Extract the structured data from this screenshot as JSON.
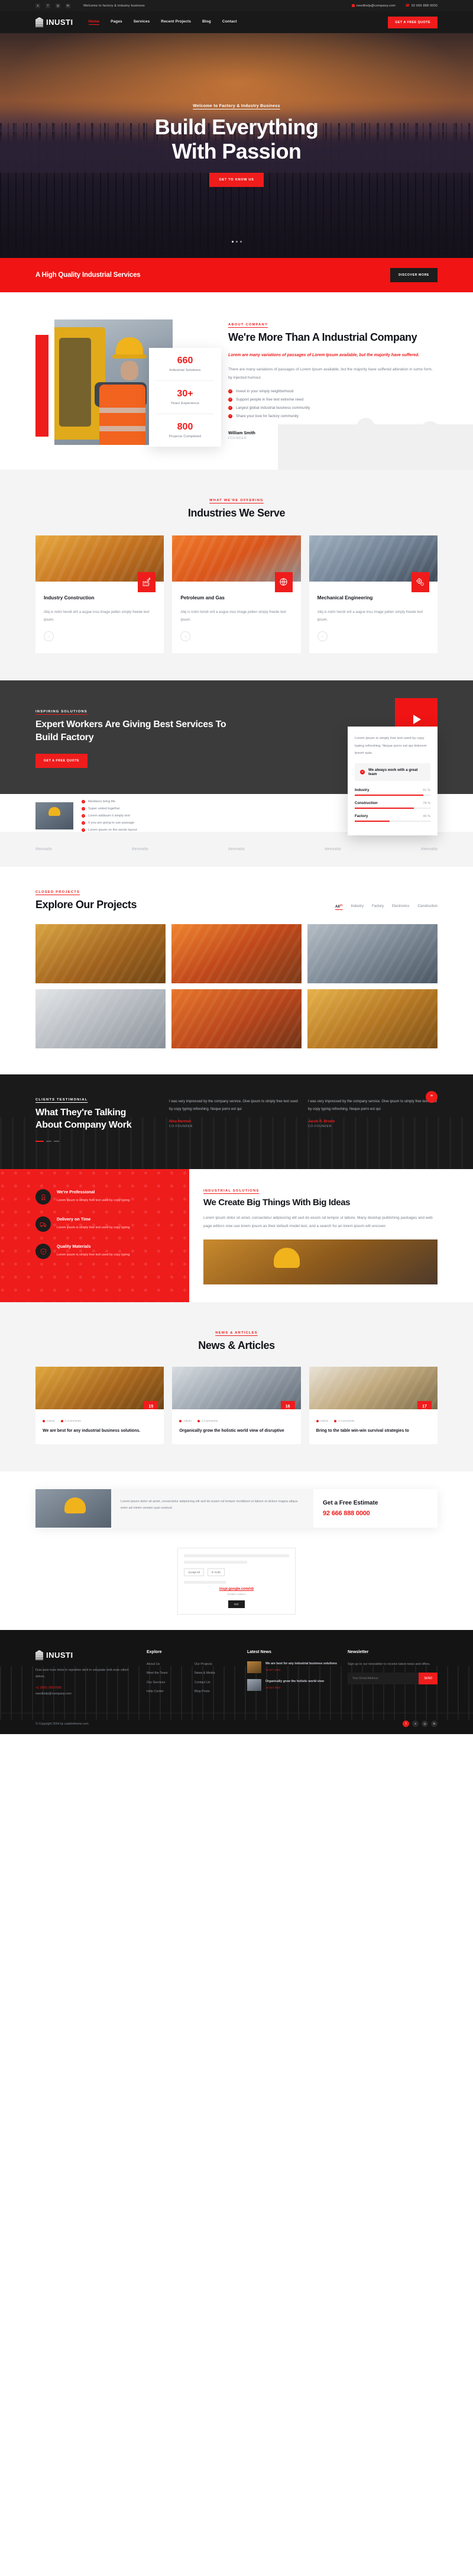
{
  "topbar": {
    "social": [
      "twitter-icon",
      "facebook-icon",
      "instagram-icon",
      "linkedin-icon"
    ],
    "welcome": "Welcome to factory & industry business",
    "email": "needhelp@company.com",
    "phone": "92 666 888 0000"
  },
  "nav": {
    "logo": "INUSTI",
    "items": [
      {
        "label": "Home",
        "active": true
      },
      {
        "label": "Pages",
        "active": false
      },
      {
        "label": "Services",
        "active": false
      },
      {
        "label": "Recent Projects",
        "active": false
      },
      {
        "label": "Blog",
        "active": false
      },
      {
        "label": "Contact",
        "active": false
      }
    ],
    "cta": "GET A FREE QUOTE"
  },
  "hero": {
    "subtitle": "Welcome to Factory & Industry Business",
    "title_line1": "Build Everything",
    "title_line2": "With Passion",
    "button": "GET TO KNOW US"
  },
  "strip": {
    "title": "A High Quality Industrial Services",
    "button": "DISCOVER MORE"
  },
  "about": {
    "eyebrow": "ABOUT COMPANY",
    "title": "We're More Than A Industrial Company",
    "lead": "Lorem are many variations of passages of Lorem Ipsum available, but the majority have suffered.",
    "paragraph": "There are many variations of passages of Lorem Ipsum available, but the majority have suffered alteration in some form, by injected humour.",
    "checks": [
      "Invest in your simply neighborhood",
      "Support people in free text extreme need",
      "Largest global industrial business community",
      "Share your love for factory community"
    ],
    "stats": [
      {
        "value": "660",
        "label": "Industrial Solutions"
      },
      {
        "value": "30+",
        "label": "Years Experience"
      },
      {
        "value": "800",
        "label": "Projects Completed"
      }
    ],
    "signer_name": "William Smith",
    "signer_role": "FOUNDER"
  },
  "industries": {
    "eyebrow": "WHAT WE'RE OFFERING",
    "title": "Industries We Serve",
    "cards": [
      {
        "icon": "factory-icon",
        "title": "Industry Construction",
        "text": "Aliq is notm hendr erit a augue insu image pellen simply freede text ipsum."
      },
      {
        "icon": "oil-pump-icon",
        "title": "Petroleum and Gas",
        "text": "Aliq is notm hendr erit a augue insu image pellen simply freede text ipsum."
      },
      {
        "icon": "gears-icon",
        "title": "Mechanical Engineering",
        "text": "Aliq is notm hendr erit a augue insu image pellen simply freede text ipsum."
      }
    ]
  },
  "expert": {
    "eyebrow": "INSPIRING SOLUTIONS",
    "title": "Expert Workers Are Giving Best Services To Build Factory",
    "button": "GET A FREE QUOTE",
    "panel_text": "Lorem ipsum is simply free text used by copy typing refreshing. Neque porro est qui dolorem ipsum quia.",
    "team_line": "We always work with a great team",
    "bars": [
      {
        "label": "Industry",
        "value": "91 %",
        "pct": 91
      },
      {
        "label": "Construction",
        "value": "78 %",
        "pct": 78
      },
      {
        "label": "Factory",
        "value": "46 %",
        "pct": 46
      }
    ],
    "worker_points": [
      "Members bring life",
      "Super united together",
      "Lorem addisum it simply text",
      "It you are going to use passage",
      "Lorem ipsum on the words layout"
    ]
  },
  "brands": [
    "#envato",
    "#envato",
    "#envato",
    "#envato",
    "#envato"
  ],
  "projects": {
    "eyebrow": "CLOSED PROJECTS",
    "title": "Explore Our Projects",
    "filters": [
      {
        "label": "All",
        "count": "(6)",
        "active": true
      },
      {
        "label": "Industry",
        "count": "",
        "active": false
      },
      {
        "label": "Factory",
        "count": "",
        "active": false
      },
      {
        "label": "Electronics",
        "count": "",
        "active": false
      },
      {
        "label": "Construction",
        "count": "",
        "active": false
      }
    ]
  },
  "testimonials": {
    "eyebrow": "CLIENTS TESTIMONIAL",
    "title": "What They're Talking About Company Work",
    "items": [
      {
        "text": "I was very impressed by the company service. Give ipsum to simply free text used by copy typing refreshing. Neque porro est qui",
        "name": "Nina Hermon",
        "role": "CO-FOUNDER"
      },
      {
        "text": "I was very impressed by the company service. Give ipsum to simply free text used by copy typing refreshing. Neque porro est qui",
        "name": "Jacob R. Brown",
        "role": "CO-FOUNDER"
      }
    ]
  },
  "bigthings": {
    "eyebrow": "INDUSTRIAL SOLUTIONS",
    "title": "We Create Big Things With Big Ideas",
    "paragraph": "Lorem ipsum dolor sit amet, consectetur adipisicing elit sed do eiusm od tempor ut labore. Many desktop publishing packages and web page editors now use lorem ipsum as their default model text, and a search for an lorem ipsum will uncover.",
    "features": [
      {
        "icon": "badge-icon",
        "title": "We're Professional",
        "text": "Lorem ipsum is simply free text used by copy typing"
      },
      {
        "icon": "truck-icon",
        "title": "Delivery on Time",
        "text": "Lorem ipsum is simply free text used by copy typing"
      },
      {
        "icon": "shield-icon",
        "title": "Quality Materials",
        "text": "Lorem ipsum is simply free text used by copy typing"
      }
    ]
  },
  "news": {
    "eyebrow": "NEWS & ARTICLES",
    "title": "News & Articles",
    "cards": [
      {
        "day": "15",
        "month": "OCT",
        "author": "Admin",
        "comments": "2 Comments",
        "title": "We are best for any industrial business solutions."
      },
      {
        "day": "16",
        "month": "OCT",
        "author": "Admin",
        "comments": "2 Comments",
        "title": "Organically grow the holistic world view of disruptive"
      },
      {
        "day": "17",
        "month": "OCT",
        "author": "Admin",
        "comments": "2 Comments",
        "title": "Bring to the table win-win survival strategies to"
      }
    ]
  },
  "estimate": {
    "text": "Lorem ipsum dolor sit amet, consectetur adipisicing elit sed do eiusm od tempor incididunt ut labore et dolore magna aliqua enim ad minim veniam quis nostrud.",
    "title": "Get a Free Estimate",
    "phone": "92 666 888 0000"
  },
  "mailcard": {
    "button1": "Accept All",
    "button2": "0 / 5.00",
    "mail": "inspi.google.com/nb",
    "sub": "Enable cookies",
    "ok": "GO"
  },
  "footer": {
    "logo": "INUSTI",
    "about": "Duis aute irure dolor in reprehen derit in voluptate velit esse cillum dolore.",
    "contact_phone": "+1 (555) 000 0000",
    "contact_email": "needhelp@company.com",
    "explore_title": "Explore",
    "explore": [
      "About Us",
      "Our Projects",
      "Meet the Team",
      "News & Media",
      "Our Services",
      "Contact Us",
      "Help Center",
      "Blog Posts"
    ],
    "news_title": "Latest News",
    "news": [
      {
        "title": "We are best for any industrial business solutions",
        "date": "15 OCT 2024"
      },
      {
        "title": "Organically grow the holistic world view",
        "date": "16 OCT 2024"
      }
    ],
    "newsletter_title": "Newsletter",
    "newsletter_text": "Sign up to our newsletter to receive latest news and offers.",
    "newsletter_placeholder": "Your Email Address",
    "newsletter_button": "SEND",
    "copyright": "© Copyright 2024 by usabletheme.com",
    "social": [
      "facebook-icon",
      "twitter-icon",
      "instagram-icon",
      "linkedin-icon"
    ]
  }
}
